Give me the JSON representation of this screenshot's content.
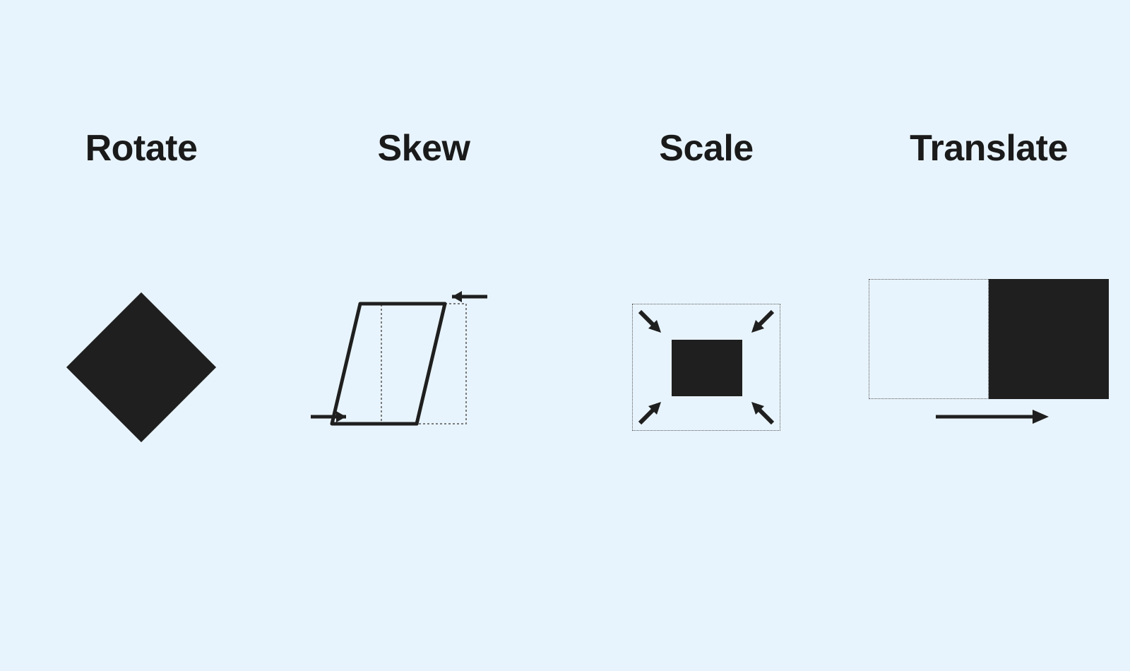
{
  "background_color": "#e8f4fd",
  "shape_color": "#1f1f1f",
  "labels": {
    "rotate": "Rotate",
    "skew": "Skew",
    "scale": "Scale",
    "translate": "Translate"
  },
  "transforms": [
    {
      "name": "Rotate",
      "description": "Square rotated 45 degrees (diamond)"
    },
    {
      "name": "Skew",
      "description": "Rectangle sheared horizontally, original dotted outline behind, opposing arrows top-right and bottom-left"
    },
    {
      "name": "Scale",
      "description": "Small filled rectangle inside larger dotted rectangle, four inward-pointing corner arrows"
    },
    {
      "name": "Translate",
      "description": "Dotted square on left, solid square shifted right, rightward arrow below"
    }
  ]
}
